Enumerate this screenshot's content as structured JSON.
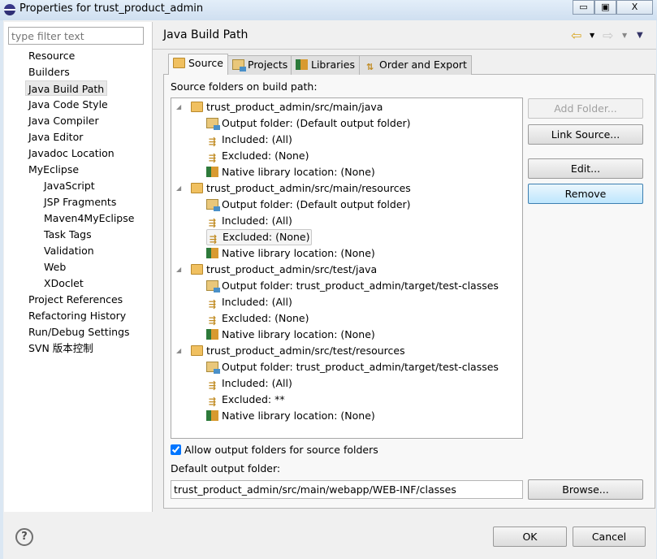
{
  "window": {
    "title": "Properties for trust_product_admin",
    "minimize": "▭",
    "maximize": "▣",
    "close": "X"
  },
  "sidebar": {
    "filter_placeholder": "type filter text",
    "items": [
      {
        "label": "Resource",
        "indent": 0
      },
      {
        "label": "Builders",
        "indent": 0
      },
      {
        "label": "Java Build Path",
        "indent": 0,
        "selected": true
      },
      {
        "label": "Java Code Style",
        "indent": 0
      },
      {
        "label": "Java Compiler",
        "indent": 0
      },
      {
        "label": "Java Editor",
        "indent": 0
      },
      {
        "label": "Javadoc Location",
        "indent": 0
      },
      {
        "label": "MyEclipse",
        "indent": 0
      },
      {
        "label": "JavaScript",
        "indent": 1
      },
      {
        "label": "JSP Fragments",
        "indent": 1
      },
      {
        "label": "Maven4MyEclipse",
        "indent": 1
      },
      {
        "label": "Task Tags",
        "indent": 1
      },
      {
        "label": "Validation",
        "indent": 1
      },
      {
        "label": "Web",
        "indent": 1
      },
      {
        "label": "XDoclet",
        "indent": 1
      },
      {
        "label": "Project References",
        "indent": 0
      },
      {
        "label": "Refactoring History",
        "indent": 0
      },
      {
        "label": "Run/Debug Settings",
        "indent": 0
      },
      {
        "label": "SVN 版本控制",
        "indent": 0
      }
    ]
  },
  "header": {
    "title": "Java Build Path",
    "back": "⇦",
    "forward": "⇨",
    "menu": "▼"
  },
  "tabs": [
    {
      "label": "Source",
      "active": true
    },
    {
      "label": "Projects"
    },
    {
      "label": "Libraries"
    },
    {
      "label": "Order and Export"
    }
  ],
  "source": {
    "label": "Source folders on build path:",
    "tree": [
      {
        "label": "trust_product_admin/src/main/java",
        "children": [
          "Output folder: (Default output folder)",
          "Included: (All)",
          "Excluded: (None)",
          "Native library location: (None)"
        ]
      },
      {
        "label": "trust_product_admin/src/main/resources",
        "children": [
          "Output folder: (Default output folder)",
          "Included: (All)",
          "Excluded: (None)",
          "Native library location: (None)"
        ]
      },
      {
        "label": "trust_product_admin/src/test/java",
        "children": [
          "Output folder: trust_product_admin/target/test-classes",
          "Included: (All)",
          "Excluded: (None)",
          "Native library location: (None)"
        ]
      },
      {
        "label": "trust_product_admin/src/test/resources",
        "children": [
          "Output folder: trust_product_admin/target/test-classes",
          "Included: (All)",
          "Excluded: **",
          "Native library location: (None)"
        ]
      }
    ],
    "buttons": {
      "add_folder": "Add Folder...",
      "link_source": "Link Source...",
      "edit": "Edit...",
      "remove": "Remove"
    },
    "allow_output_label": "Allow output folders for source folders",
    "allow_output_checked": true,
    "default_output_label": "Default output folder:",
    "default_output_value": "trust_product_admin/src/main/webapp/WEB-INF/classes",
    "browse": "Browse..."
  },
  "footer": {
    "help": "?",
    "ok": "OK",
    "cancel": "Cancel"
  }
}
